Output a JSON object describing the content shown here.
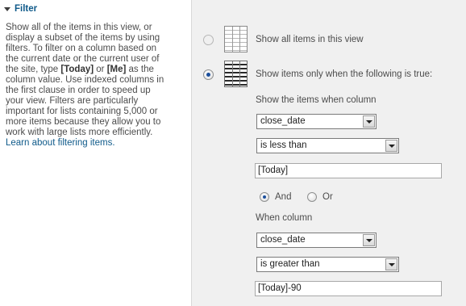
{
  "left": {
    "title": "Filter",
    "description_lines": [
      "Show all of the items in this view, or",
      "display a subset of the items by using",
      "filters. To filter on a column based on",
      "the current date or the current user of",
      "the site, type [Today] or [Me] as the",
      "column value. Use indexed columns in",
      "the first clause in order to speed up",
      "your view. Filters are particularly",
      "important for lists containing 5,000 or",
      "more items because they allow you to",
      "work with large lists more efficiently."
    ],
    "link": "Learn about filtering items."
  },
  "options": {
    "show_all": "Show all items in this view",
    "show_when": "Show items only when the following is true:"
  },
  "filter": {
    "column_label": "Show the items when column",
    "clause1": {
      "column": "close_date",
      "operator": "is less than",
      "value": "[Today]"
    },
    "and_label": "And",
    "or_label": "Or",
    "when_column_label": "When column",
    "clause2": {
      "column": "close_date",
      "operator": "is greater than",
      "value": "[Today]-90"
    }
  },
  "icons": {
    "collapse": "collapse-arrow-icon",
    "all_items": "list-grid-icon",
    "filtered_items": "filtered-grid-icon"
  }
}
